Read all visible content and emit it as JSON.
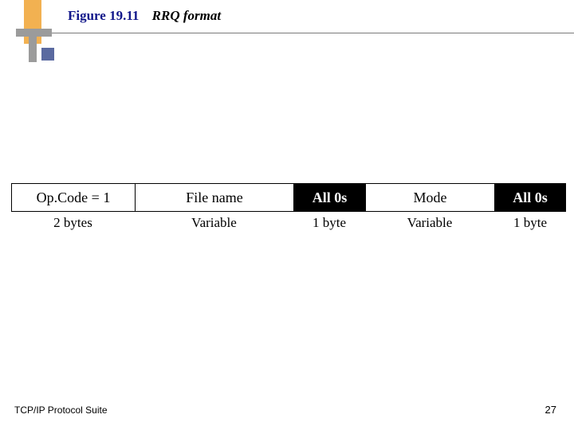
{
  "figure": {
    "number": "Figure 19.11",
    "caption": "RRQ format"
  },
  "packet": {
    "fields": {
      "opcode": "Op.Code = 1",
      "filename": "File name",
      "zero1": "All 0s",
      "mode": "Mode",
      "zero2": "All 0s"
    },
    "sizes": {
      "opcode": "2 bytes",
      "filename": "Variable",
      "zero1": "1 byte",
      "mode": "Variable",
      "zero2": "1 byte"
    }
  },
  "footer": {
    "source": "TCP/IP Protocol Suite",
    "page": "27"
  }
}
